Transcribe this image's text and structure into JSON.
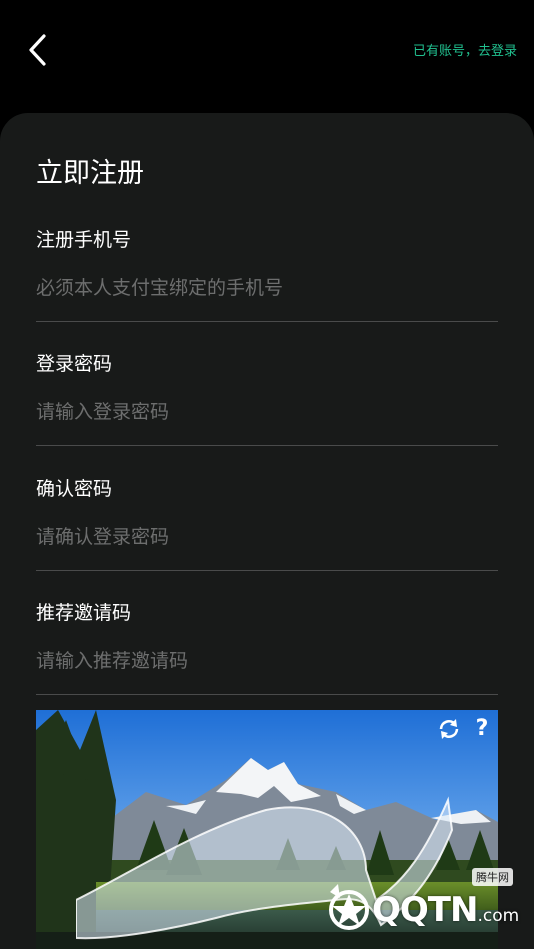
{
  "header": {
    "back_icon": "chevron-left-icon",
    "login_link": "已有账号，去登录",
    "accent_color": "#21c08f"
  },
  "form": {
    "title": "立即注册",
    "fields": [
      {
        "label": "注册手机号",
        "placeholder": "必须本人支付宝绑定的手机号",
        "value": ""
      },
      {
        "label": "登录密码",
        "placeholder": "请输入登录密码",
        "value": ""
      },
      {
        "label": "确认密码",
        "placeholder": "请确认登录密码",
        "value": ""
      },
      {
        "label": "推荐邀请码",
        "placeholder": "请输入推荐邀请码",
        "value": ""
      }
    ]
  },
  "captcha": {
    "refresh_icon": "refresh-icon",
    "help_label": "?"
  },
  "watermark": {
    "site_name": "腾牛网",
    "logo_main": "QQTN",
    "logo_suffix": ".com"
  }
}
